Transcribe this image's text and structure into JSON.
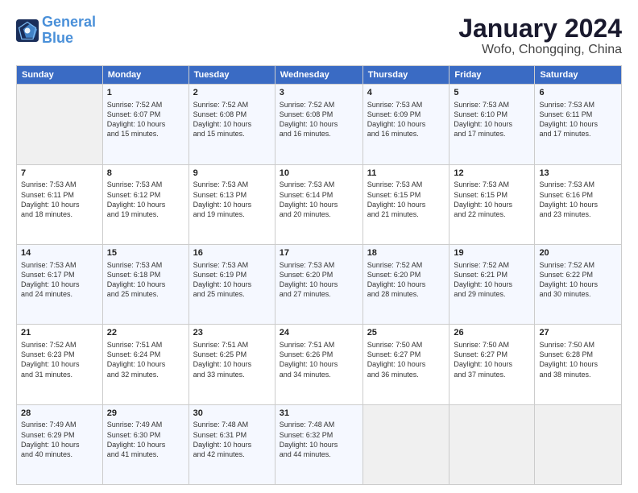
{
  "logo": {
    "line1": "General",
    "line2": "Blue"
  },
  "title": "January 2024",
  "location": "Wofo, Chongqing, China",
  "headers": [
    "Sunday",
    "Monday",
    "Tuesday",
    "Wednesday",
    "Thursday",
    "Friday",
    "Saturday"
  ],
  "weeks": [
    [
      {
        "day": "",
        "info": ""
      },
      {
        "day": "1",
        "info": "Sunrise: 7:52 AM\nSunset: 6:07 PM\nDaylight: 10 hours\nand 15 minutes."
      },
      {
        "day": "2",
        "info": "Sunrise: 7:52 AM\nSunset: 6:08 PM\nDaylight: 10 hours\nand 15 minutes."
      },
      {
        "day": "3",
        "info": "Sunrise: 7:52 AM\nSunset: 6:08 PM\nDaylight: 10 hours\nand 16 minutes."
      },
      {
        "day": "4",
        "info": "Sunrise: 7:53 AM\nSunset: 6:09 PM\nDaylight: 10 hours\nand 16 minutes."
      },
      {
        "day": "5",
        "info": "Sunrise: 7:53 AM\nSunset: 6:10 PM\nDaylight: 10 hours\nand 17 minutes."
      },
      {
        "day": "6",
        "info": "Sunrise: 7:53 AM\nSunset: 6:11 PM\nDaylight: 10 hours\nand 17 minutes."
      }
    ],
    [
      {
        "day": "7",
        "info": "Sunrise: 7:53 AM\nSunset: 6:11 PM\nDaylight: 10 hours\nand 18 minutes."
      },
      {
        "day": "8",
        "info": "Sunrise: 7:53 AM\nSunset: 6:12 PM\nDaylight: 10 hours\nand 19 minutes."
      },
      {
        "day": "9",
        "info": "Sunrise: 7:53 AM\nSunset: 6:13 PM\nDaylight: 10 hours\nand 19 minutes."
      },
      {
        "day": "10",
        "info": "Sunrise: 7:53 AM\nSunset: 6:14 PM\nDaylight: 10 hours\nand 20 minutes."
      },
      {
        "day": "11",
        "info": "Sunrise: 7:53 AM\nSunset: 6:15 PM\nDaylight: 10 hours\nand 21 minutes."
      },
      {
        "day": "12",
        "info": "Sunrise: 7:53 AM\nSunset: 6:15 PM\nDaylight: 10 hours\nand 22 minutes."
      },
      {
        "day": "13",
        "info": "Sunrise: 7:53 AM\nSunset: 6:16 PM\nDaylight: 10 hours\nand 23 minutes."
      }
    ],
    [
      {
        "day": "14",
        "info": "Sunrise: 7:53 AM\nSunset: 6:17 PM\nDaylight: 10 hours\nand 24 minutes."
      },
      {
        "day": "15",
        "info": "Sunrise: 7:53 AM\nSunset: 6:18 PM\nDaylight: 10 hours\nand 25 minutes."
      },
      {
        "day": "16",
        "info": "Sunrise: 7:53 AM\nSunset: 6:19 PM\nDaylight: 10 hours\nand 25 minutes."
      },
      {
        "day": "17",
        "info": "Sunrise: 7:53 AM\nSunset: 6:20 PM\nDaylight: 10 hours\nand 27 minutes."
      },
      {
        "day": "18",
        "info": "Sunrise: 7:52 AM\nSunset: 6:20 PM\nDaylight: 10 hours\nand 28 minutes."
      },
      {
        "day": "19",
        "info": "Sunrise: 7:52 AM\nSunset: 6:21 PM\nDaylight: 10 hours\nand 29 minutes."
      },
      {
        "day": "20",
        "info": "Sunrise: 7:52 AM\nSunset: 6:22 PM\nDaylight: 10 hours\nand 30 minutes."
      }
    ],
    [
      {
        "day": "21",
        "info": "Sunrise: 7:52 AM\nSunset: 6:23 PM\nDaylight: 10 hours\nand 31 minutes."
      },
      {
        "day": "22",
        "info": "Sunrise: 7:51 AM\nSunset: 6:24 PM\nDaylight: 10 hours\nand 32 minutes."
      },
      {
        "day": "23",
        "info": "Sunrise: 7:51 AM\nSunset: 6:25 PM\nDaylight: 10 hours\nand 33 minutes."
      },
      {
        "day": "24",
        "info": "Sunrise: 7:51 AM\nSunset: 6:26 PM\nDaylight: 10 hours\nand 34 minutes."
      },
      {
        "day": "25",
        "info": "Sunrise: 7:50 AM\nSunset: 6:27 PM\nDaylight: 10 hours\nand 36 minutes."
      },
      {
        "day": "26",
        "info": "Sunrise: 7:50 AM\nSunset: 6:27 PM\nDaylight: 10 hours\nand 37 minutes."
      },
      {
        "day": "27",
        "info": "Sunrise: 7:50 AM\nSunset: 6:28 PM\nDaylight: 10 hours\nand 38 minutes."
      }
    ],
    [
      {
        "day": "28",
        "info": "Sunrise: 7:49 AM\nSunset: 6:29 PM\nDaylight: 10 hours\nand 40 minutes."
      },
      {
        "day": "29",
        "info": "Sunrise: 7:49 AM\nSunset: 6:30 PM\nDaylight: 10 hours\nand 41 minutes."
      },
      {
        "day": "30",
        "info": "Sunrise: 7:48 AM\nSunset: 6:31 PM\nDaylight: 10 hours\nand 42 minutes."
      },
      {
        "day": "31",
        "info": "Sunrise: 7:48 AM\nSunset: 6:32 PM\nDaylight: 10 hours\nand 44 minutes."
      },
      {
        "day": "",
        "info": ""
      },
      {
        "day": "",
        "info": ""
      },
      {
        "day": "",
        "info": ""
      }
    ]
  ]
}
